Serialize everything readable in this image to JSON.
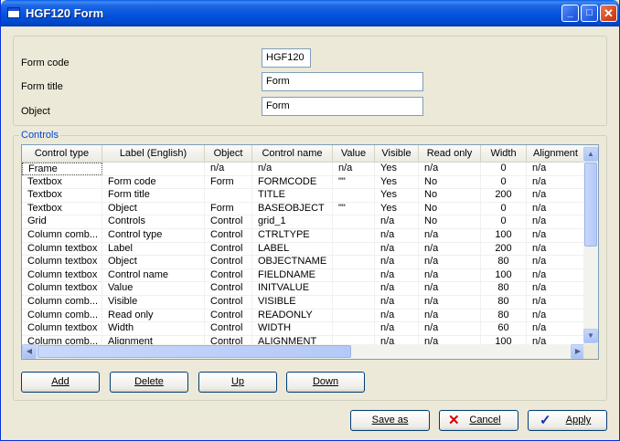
{
  "window": {
    "title": "HGF120 Form",
    "minimize_glyph": "_",
    "maximize_glyph": "□",
    "close_glyph": "✕"
  },
  "form": {
    "code_label": "Form code",
    "code_value": "HGF120",
    "title_label": "Form title",
    "title_value": "Form",
    "object_label": "Object",
    "object_value": "Form"
  },
  "controls": {
    "legend": "Controls",
    "columns": [
      "Control type",
      "Label (English)",
      "Object",
      "Control name",
      "Value",
      "Visible",
      "Read only",
      "Width",
      "Alignment"
    ],
    "rows": [
      [
        "Frame",
        "",
        "n/a",
        "n/a",
        "n/a",
        "Yes",
        "n/a",
        "0",
        "n/a"
      ],
      [
        "Textbox",
        "Form code",
        "Form",
        "FORMCODE",
        "\"\"",
        "Yes",
        "No",
        "0",
        "n/a"
      ],
      [
        "Textbox",
        "Form title",
        "",
        "TITLE",
        "",
        "Yes",
        "No",
        "200",
        "n/a"
      ],
      [
        "Textbox",
        "Object",
        "Form",
        "BASEOBJECT",
        "\"\"",
        "Yes",
        "No",
        "0",
        "n/a"
      ],
      [
        "Grid",
        "Controls",
        "Control",
        "grid_1",
        "",
        "n/a",
        "No",
        "0",
        "n/a"
      ],
      [
        "Column comb...",
        "Control type",
        "Control",
        "CTRLTYPE",
        "",
        "n/a",
        "n/a",
        "100",
        "n/a"
      ],
      [
        "Column textbox",
        "Label",
        "Control",
        "LABEL",
        "",
        "n/a",
        "n/a",
        "200",
        "n/a"
      ],
      [
        "Column textbox",
        "Object",
        "Control",
        "OBJECTNAME",
        "",
        "n/a",
        "n/a",
        "80",
        "n/a"
      ],
      [
        "Column textbox",
        "Control name",
        "Control",
        "FIELDNAME",
        "",
        "n/a",
        "n/a",
        "100",
        "n/a"
      ],
      [
        "Column textbox",
        "Value",
        "Control",
        "INITVALUE",
        "",
        "n/a",
        "n/a",
        "80",
        "n/a"
      ],
      [
        "Column comb...",
        "Visible",
        "Control",
        "VISIBLE",
        "",
        "n/a",
        "n/a",
        "80",
        "n/a"
      ],
      [
        "Column comb...",
        "Read only",
        "Control",
        "READONLY",
        "",
        "n/a",
        "n/a",
        "80",
        "n/a"
      ],
      [
        "Column textbox",
        "Width",
        "Control",
        "WIDTH",
        "",
        "n/a",
        "n/a",
        "60",
        "n/a"
      ],
      [
        "Column comb...",
        "Alignment",
        "Control",
        "ALIGNMENT",
        "",
        "n/a",
        "n/a",
        "100",
        "n/a"
      ]
    ]
  },
  "buttons": {
    "add": "Add",
    "delete": "Delete",
    "up": "Up",
    "down": "Down",
    "save_as": "Save as",
    "cancel": "Cancel",
    "cancel_icon": "✕",
    "apply": "Apply",
    "apply_icon": "✓"
  },
  "colors": {
    "accent": "#0046d5",
    "cancel_icon": "#d40000",
    "apply_icon": "#1530b8"
  }
}
